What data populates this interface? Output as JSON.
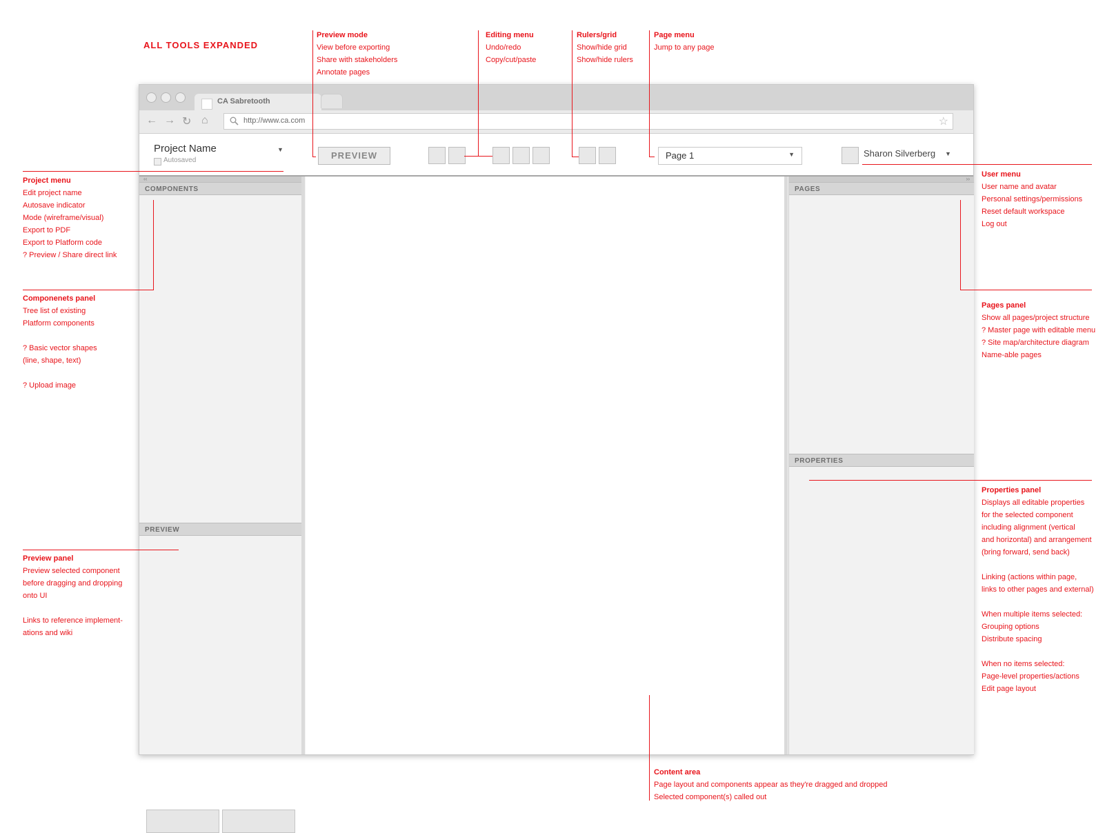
{
  "page_heading": "ALL TOOLS EXPANDED",
  "browser": {
    "tab_title": "CA Sabretooth",
    "url": "http://www.ca.com"
  },
  "app": {
    "project_name": "Project Name",
    "autosave_label": "Autosaved",
    "preview_label": "PREVIEW",
    "page_select_value": "Page 1",
    "user_name": "Sharon Silverberg",
    "collapse_left": "‹‹",
    "collapse_right": "››"
  },
  "panels": {
    "components": "COMPONENTS",
    "preview": "PREVIEW",
    "pages": "PAGES",
    "properties": "PROPERTIES"
  },
  "annotations": {
    "preview_mode": {
      "title": "Preview mode",
      "lines": [
        "View before exporting",
        "Share with stakeholders",
        "Annotate pages"
      ]
    },
    "editing_menu": {
      "title": "Editing menu",
      "lines": [
        "Undo/redo",
        "Copy/cut/paste"
      ]
    },
    "rulers_grid": {
      "title": "Rulers/grid",
      "lines": [
        "Show/hide grid",
        "Show/hide rulers"
      ]
    },
    "page_menu": {
      "title": "Page menu",
      "lines": [
        "Jump to any page"
      ]
    },
    "project_menu": {
      "title": "Project menu",
      "lines": [
        "Edit project name",
        "Autosave indicator",
        "Mode (wireframe/visual)",
        "Export to PDF",
        "Export to Platform code",
        "? Preview / Share direct link"
      ]
    },
    "components_panel": {
      "title": "Componenets panel",
      "lines": [
        "Tree list of existing",
        "Platform components",
        "",
        "? Basic vector shapes",
        "(line, shape, text)",
        "",
        "? Upload image"
      ]
    },
    "preview_panel": {
      "title": "Preview panel",
      "lines": [
        "Preview selected component",
        "before dragging and dropping",
        "onto UI",
        "",
        "Links to reference implement-",
        "ations and wiki"
      ]
    },
    "user_menu": {
      "title": "User menu",
      "lines": [
        "User name and avatar",
        "Personal settings/permissions",
        "Reset default workspace",
        "Log out"
      ]
    },
    "pages_panel": {
      "title": "Pages panel",
      "lines": [
        "Show all pages/project structure",
        "? Master page with editable menu",
        "? Site map/architecture diagram",
        "Name-able pages"
      ]
    },
    "properties_panel": {
      "title": "Properties panel",
      "lines": [
        "Displays all editable properties",
        "for the selected component",
        "including alignment (vertical",
        "and horizontal) and arrangement",
        "(bring forward, send back)",
        "",
        "Linking (actions within page,",
        "links to other pages and external)",
        "",
        "When multiple items selected:",
        "Grouping options",
        "Distribute spacing",
        "",
        "When no items selected:",
        "Page-level properties/actions",
        "Edit page layout"
      ]
    },
    "content_area": {
      "title": "Content area",
      "lines": [
        "Page layout and components appear as they're dragged and dropped",
        "Selected component(s) called out"
      ]
    }
  },
  "colors": {
    "annotation": "#e8141b",
    "panel_bg": "#f2f2f2",
    "header_bg": "#d6d6d6"
  },
  "icons": [
    "back-icon",
    "forward-icon",
    "reload-icon",
    "home-icon",
    "search-icon",
    "star-icon",
    "dropdown-caret-icon"
  ]
}
